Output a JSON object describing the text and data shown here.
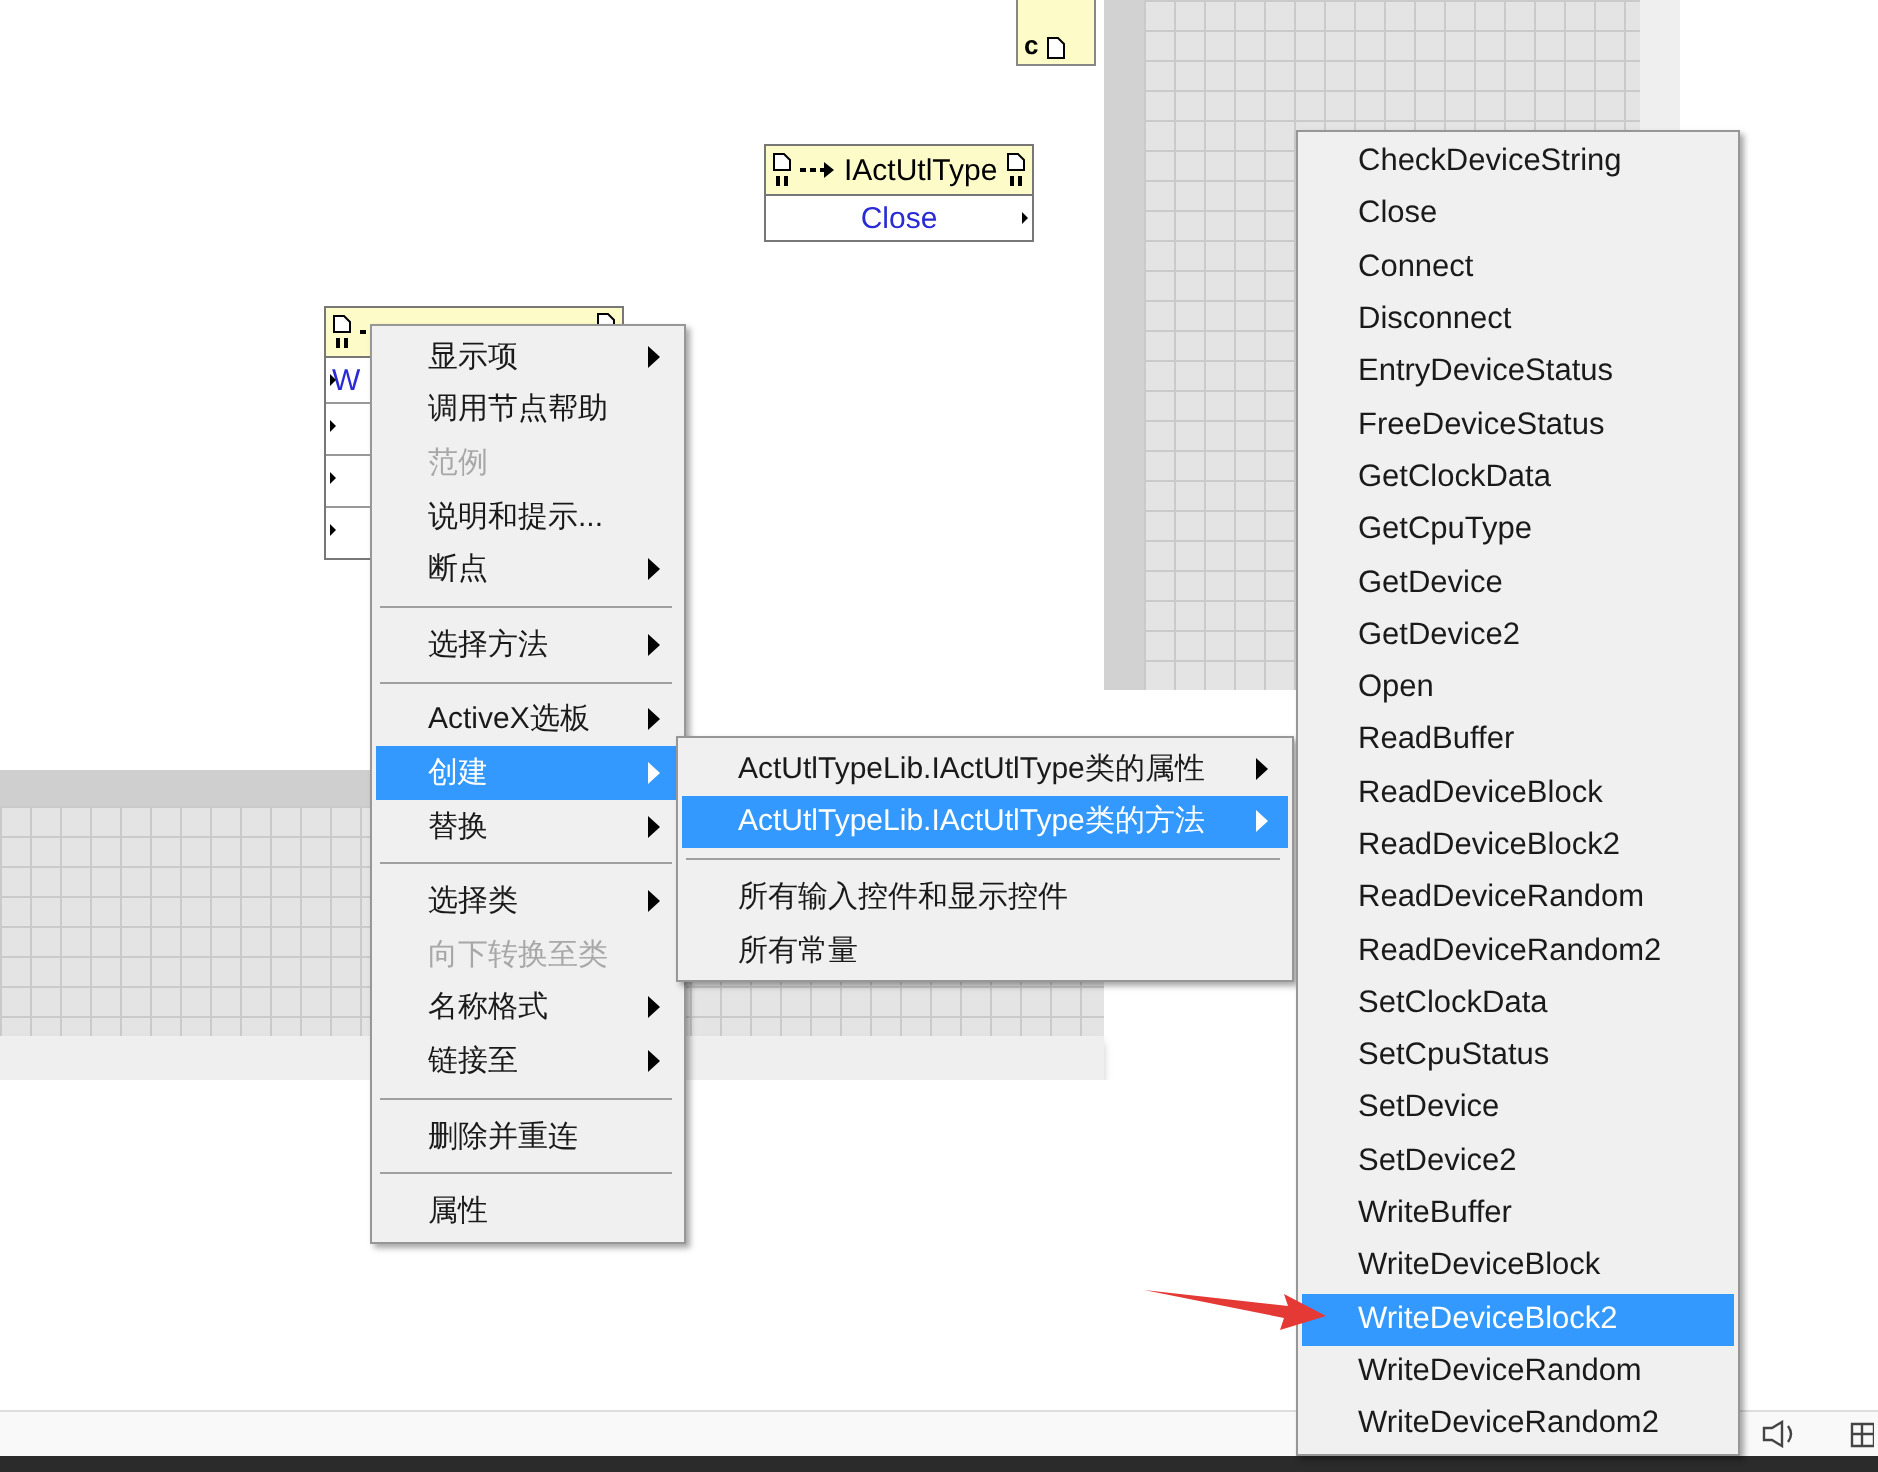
{
  "diagram": {
    "constant_node": {
      "label": "c"
    },
    "nodes": [
      {
        "kind": "invoke",
        "title": "IActUtlType",
        "rows": [
          "Close"
        ]
      },
      {
        "kind": "invoke-partial",
        "rows": [
          "W",
          "",
          "",
          ""
        ]
      }
    ]
  },
  "menus": [
    {
      "items": [
        {
          "kind": "item",
          "label": "显示项",
          "submenu": true,
          "disabled": false,
          "selected": false
        },
        {
          "kind": "item",
          "label": "调用节点帮助",
          "submenu": false,
          "disabled": false,
          "selected": false
        },
        {
          "kind": "item",
          "label": "范例",
          "submenu": false,
          "disabled": true,
          "selected": false
        },
        {
          "kind": "item",
          "label": "说明和提示...",
          "submenu": false,
          "disabled": false,
          "selected": false
        },
        {
          "kind": "item",
          "label": "断点",
          "submenu": true,
          "disabled": false,
          "selected": false
        },
        {
          "kind": "separator"
        },
        {
          "kind": "item",
          "label": "选择方法",
          "submenu": true,
          "disabled": false,
          "selected": false
        },
        {
          "kind": "separator"
        },
        {
          "kind": "item",
          "label": "ActiveX选板",
          "submenu": true,
          "disabled": false,
          "selected": false
        },
        {
          "kind": "item",
          "label": "创建",
          "submenu": true,
          "disabled": false,
          "selected": true
        },
        {
          "kind": "item",
          "label": "替换",
          "submenu": true,
          "disabled": false,
          "selected": false
        },
        {
          "kind": "separator"
        },
        {
          "kind": "item",
          "label": "选择类",
          "submenu": true,
          "disabled": false,
          "selected": false
        },
        {
          "kind": "item",
          "label": "向下转换至类",
          "submenu": false,
          "disabled": true,
          "selected": false
        },
        {
          "kind": "item",
          "label": "名称格式",
          "submenu": true,
          "disabled": false,
          "selected": false
        },
        {
          "kind": "item",
          "label": "链接至",
          "submenu": true,
          "disabled": false,
          "selected": false
        },
        {
          "kind": "separator"
        },
        {
          "kind": "item",
          "label": "删除并重连",
          "submenu": false,
          "disabled": false,
          "selected": false
        },
        {
          "kind": "separator"
        },
        {
          "kind": "item",
          "label": "属性",
          "submenu": false,
          "disabled": false,
          "selected": false
        }
      ]
    },
    {
      "items": [
        {
          "kind": "item",
          "label": "ActUtlTypeLib.IActUtlType类的属性",
          "submenu": true,
          "disabled": false,
          "selected": false
        },
        {
          "kind": "item",
          "label": "ActUtlTypeLib.IActUtlType类的方法",
          "submenu": true,
          "disabled": false,
          "selected": true
        },
        {
          "kind": "separator"
        },
        {
          "kind": "item",
          "label": "所有输入控件和显示控件",
          "submenu": false,
          "disabled": false,
          "selected": false
        },
        {
          "kind": "item",
          "label": "所有常量",
          "submenu": false,
          "disabled": false,
          "selected": false
        }
      ]
    },
    {
      "items": [
        {
          "kind": "item",
          "label": "CheckDeviceString",
          "submenu": false,
          "disabled": false,
          "selected": false
        },
        {
          "kind": "item",
          "label": "Close",
          "submenu": false,
          "disabled": false,
          "selected": false
        },
        {
          "kind": "item",
          "label": "Connect",
          "submenu": false,
          "disabled": false,
          "selected": false
        },
        {
          "kind": "item",
          "label": "Disconnect",
          "submenu": false,
          "disabled": false,
          "selected": false
        },
        {
          "kind": "item",
          "label": "EntryDeviceStatus",
          "submenu": false,
          "disabled": false,
          "selected": false
        },
        {
          "kind": "item",
          "label": "FreeDeviceStatus",
          "submenu": false,
          "disabled": false,
          "selected": false
        },
        {
          "kind": "item",
          "label": "GetClockData",
          "submenu": false,
          "disabled": false,
          "selected": false
        },
        {
          "kind": "item",
          "label": "GetCpuType",
          "submenu": false,
          "disabled": false,
          "selected": false
        },
        {
          "kind": "item",
          "label": "GetDevice",
          "submenu": false,
          "disabled": false,
          "selected": false
        },
        {
          "kind": "item",
          "label": "GetDevice2",
          "submenu": false,
          "disabled": false,
          "selected": false
        },
        {
          "kind": "item",
          "label": "Open",
          "submenu": false,
          "disabled": false,
          "selected": false
        },
        {
          "kind": "item",
          "label": "ReadBuffer",
          "submenu": false,
          "disabled": false,
          "selected": false
        },
        {
          "kind": "item",
          "label": "ReadDeviceBlock",
          "submenu": false,
          "disabled": false,
          "selected": false
        },
        {
          "kind": "item",
          "label": "ReadDeviceBlock2",
          "submenu": false,
          "disabled": false,
          "selected": false
        },
        {
          "kind": "item",
          "label": "ReadDeviceRandom",
          "submenu": false,
          "disabled": false,
          "selected": false
        },
        {
          "kind": "item",
          "label": "ReadDeviceRandom2",
          "submenu": false,
          "disabled": false,
          "selected": false
        },
        {
          "kind": "item",
          "label": "SetClockData",
          "submenu": false,
          "disabled": false,
          "selected": false
        },
        {
          "kind": "item",
          "label": "SetCpuStatus",
          "submenu": false,
          "disabled": false,
          "selected": false
        },
        {
          "kind": "item",
          "label": "SetDevice",
          "submenu": false,
          "disabled": false,
          "selected": false
        },
        {
          "kind": "item",
          "label": "SetDevice2",
          "submenu": false,
          "disabled": false,
          "selected": false
        },
        {
          "kind": "item",
          "label": "WriteBuffer",
          "submenu": false,
          "disabled": false,
          "selected": false
        },
        {
          "kind": "item",
          "label": "WriteDeviceBlock",
          "submenu": false,
          "disabled": false,
          "selected": false
        },
        {
          "kind": "item",
          "label": "WriteDeviceBlock2",
          "submenu": false,
          "disabled": false,
          "selected": true
        },
        {
          "kind": "item",
          "label": "WriteDeviceRandom",
          "submenu": false,
          "disabled": false,
          "selected": false
        },
        {
          "kind": "item",
          "label": "WriteDeviceRandom2",
          "submenu": false,
          "disabled": false,
          "selected": false
        }
      ]
    }
  ]
}
